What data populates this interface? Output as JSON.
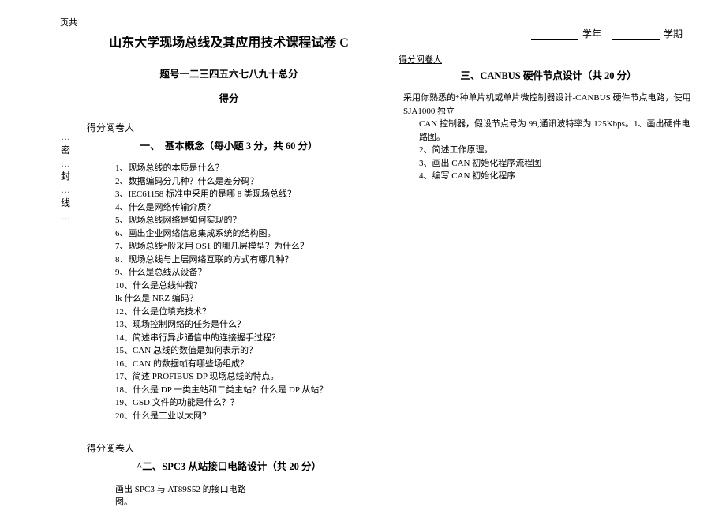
{
  "page_label": "页共",
  "title": "山东大学现场总线及其应用技术课程试卷 C",
  "vertical_text": "…\n密\n…\n封\n…\n线\n…",
  "table_header": "题号一二三四五六七八九十总分",
  "score_label": "得分",
  "grader_label": "得分阅卷人",
  "section1_title": "一、　基本概念（每小题 3 分，共 60 分）",
  "q": {
    "1": "1、现场总线的本质是什么？",
    "2": "2、数据编码分几种？什么是差分码？",
    "3": "3、IEC61158 标准中采用的是哪 8 类现场总线？",
    "4": "4、什么是网络传输介质？",
    "5": "5、现场总线网络是如何实现的？",
    "6": "6、画出企业网络信息集成系统的结构图。",
    "7": "7、现场总线*般采用 OS1 的哪几层模型？为什么？",
    "8": "8、现场总线与上层网络互联的方式有哪几种？",
    "9": "9、什么是总线从设备？",
    "10": "10、什么是总线仲裁？",
    "11": "lk 什么是 NRZ 编码？",
    "12": "12、什么是位填充技术？",
    "13": "13、现场控制网络的任务是什么？",
    "14": "14、简述串行异步通信中的连接握手过程？",
    "15": "15、CAN 总线的数值是如何表示的？",
    "16": "16、CAN 的数据帧有哪些场组成？",
    "17": "17、简述 PROFIBUS-DP 现场总线的特点。",
    "18": "18、什么是 DP 一类主站和二类主站？什么是 DP 从站？",
    "19": "19、GSD 文件的功能是什么？？",
    "20": "20、什么是工业以太网？"
  },
  "section2_caret_title": "^二、SPC3 从站接口电路设计（共 20 分）",
  "section2_body1": "画出 SPC3 与 AT89S52 的接口电路",
  "section2_body2": "图。",
  "year_label": "学年",
  "term_label": "学期",
  "section3_title": "三、CANBUS 硬件节点设计（共 20 分）",
  "s3_line1": "采用你熟悉的*种单片机或单片微控制器设计-CANBUS 硬件节点电路，使用 SJA1000 独立",
  "s3_line2": "CAN 控制器，假设节点号为 99,通讯波特率为 125Kbps。1、画出硬件电路图。",
  "s3_line3": "2、简述工作原理。",
  "s3_line4": "3、画出 CAN 初始化程序流程图",
  "s3_line5": "4、编写 CAN 初始化程序"
}
